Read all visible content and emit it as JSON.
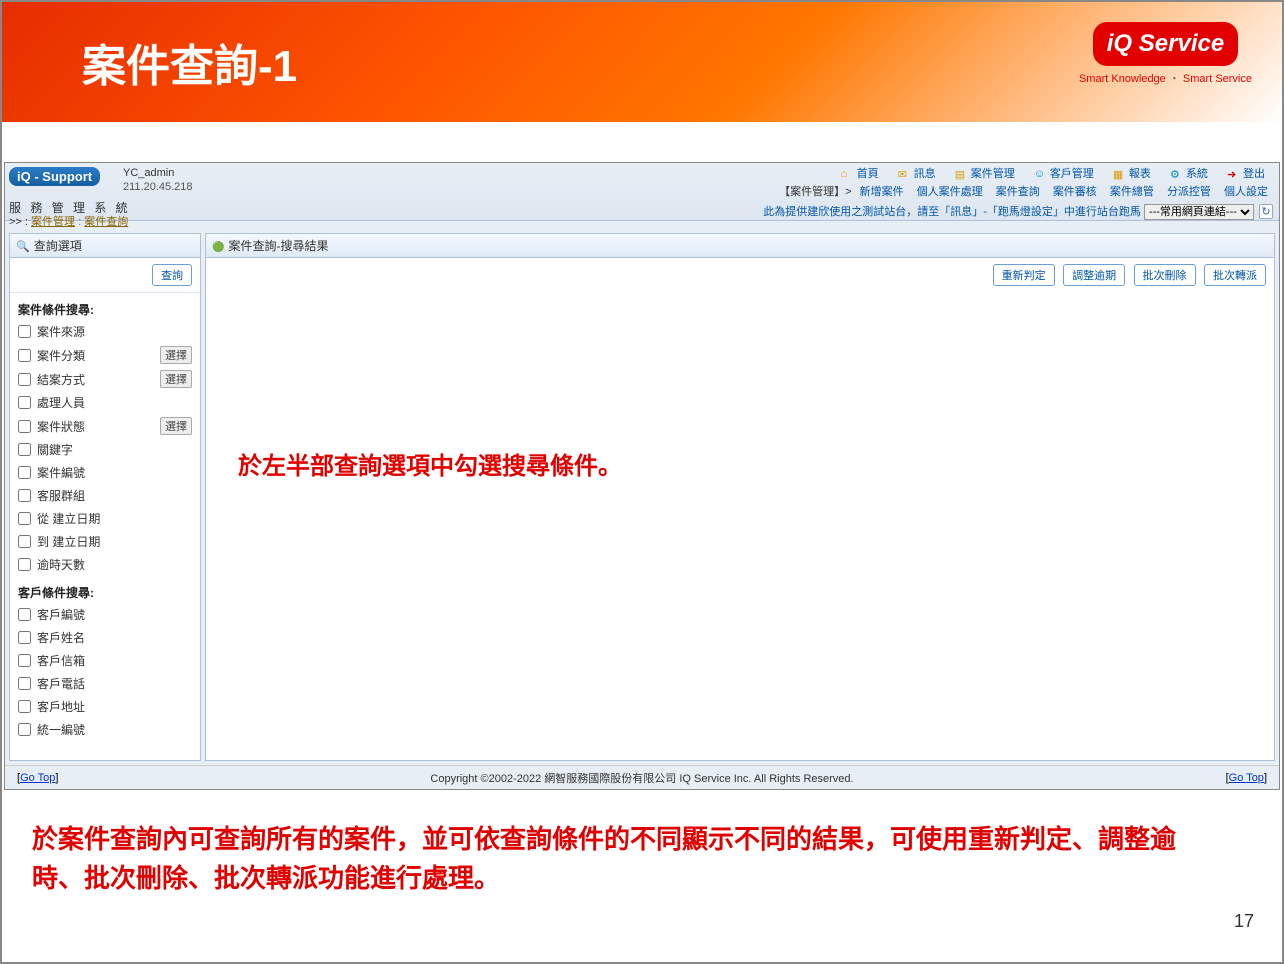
{
  "slide": {
    "title": "案件查詢-1",
    "logo_text": "iQ Service",
    "logo_tag_left": "Smart Knowledge",
    "logo_tag_sep": " ・ ",
    "logo_tag_right": "Smart Service",
    "page_number": "17"
  },
  "app": {
    "logo": "iQ - Support",
    "user": "YC_admin",
    "ip": "211.20.45.218",
    "system_name": "服 務 管 理 系 統",
    "breadcrumb_prefix": ">> :",
    "breadcrumb_1": "案件管理",
    "breadcrumb_2": "案件查詢",
    "marquee_text": "此為提供建欣使用之測試站台，請至「訊息」-「跑馬燈設定」中進行站台跑馬",
    "quicklink_placeholder": "---常用網頁連結---"
  },
  "topnav": {
    "home": "首頁",
    "message": "訊息",
    "case": "案件管理",
    "customer": "客戶管理",
    "report": "報表",
    "system": "系統",
    "logout": "登出"
  },
  "subnav": {
    "prefix": "【案件管理】>",
    "new_case": "新增案件",
    "personal": "個人案件處理",
    "query": "案件查詢",
    "review": "案件審核",
    "manage": "案件總管",
    "dispatch": "分派控管",
    "personal_set": "個人設定"
  },
  "left": {
    "title": "查詢選項",
    "search_btn": "查詢",
    "group1": "案件條件搜尋:",
    "items1": [
      {
        "label": "案件來源"
      },
      {
        "label": "案件分類",
        "select": true
      },
      {
        "label": "結案方式",
        "select": true
      },
      {
        "label": "處理人員"
      },
      {
        "label": "案件狀態",
        "select": true
      },
      {
        "label": "關鍵字"
      },
      {
        "label": "案件編號"
      },
      {
        "label": "客服群組"
      },
      {
        "label": "從 建立日期"
      },
      {
        "label": "到 建立日期"
      },
      {
        "label": "逾時天數"
      }
    ],
    "group2": "客戶條件搜尋:",
    "items2": [
      {
        "label": "客戶編號"
      },
      {
        "label": "客戶姓名"
      },
      {
        "label": "客戶信箱"
      },
      {
        "label": "客戶電話"
      },
      {
        "label": "客戶地址"
      },
      {
        "label": "統一編號"
      }
    ],
    "select_btn": "選擇"
  },
  "right": {
    "title": "案件查詢-搜尋結果",
    "actions": {
      "rejudge": "重新判定",
      "adjust": "調整逾期",
      "batch_del": "批次刪除",
      "batch_trans": "批次轉派"
    }
  },
  "annotations": {
    "inline": "於左半部查詢選項中勾選搜尋條件。",
    "footer": "於案件查詢內可查詢所有的案件，並可依查詢條件的不同顯示不同的結果，可使用重新判定、調整逾時、批次刪除、批次轉派功能進行處理。"
  },
  "footer": {
    "gotop": "Go Top",
    "copyright": "Copyright ©2002-2022 網智服務國際股份有限公司 IQ Service Inc. All Rights Reserved."
  }
}
